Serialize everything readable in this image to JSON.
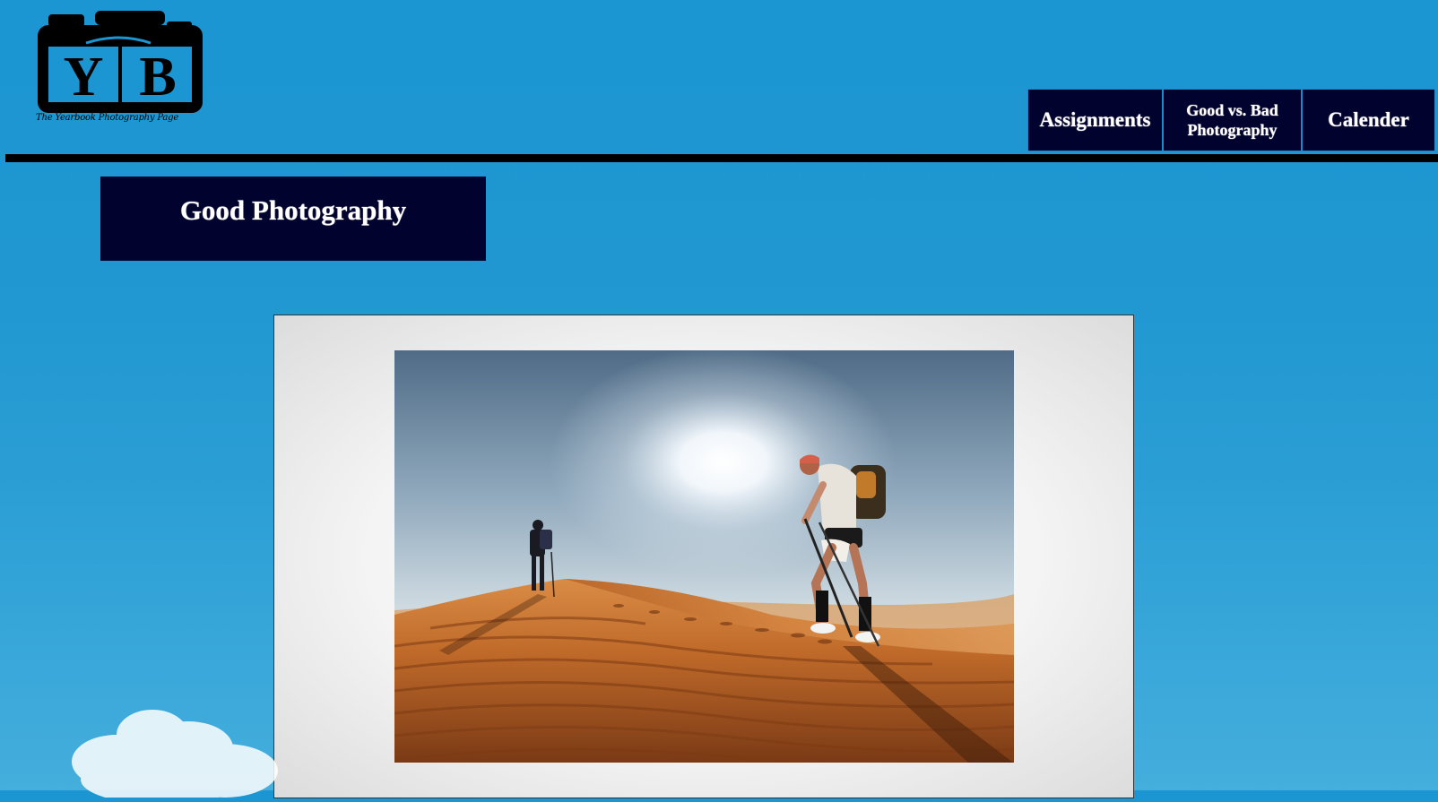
{
  "logo": {
    "letters": "YB",
    "tagline": "The Yearbook Photography Page"
  },
  "nav": {
    "assignments": "Assignments",
    "good_vs_bad": "Good vs. Bad Photography",
    "calender": "Calender"
  },
  "page": {
    "title": "Good Photography"
  },
  "colors": {
    "background": "#1b96d2",
    "nav_bg": "#02022e",
    "title_bg": "#02022e",
    "divider": "#000000"
  },
  "icons": {
    "logo": "camera-yb-logo"
  }
}
